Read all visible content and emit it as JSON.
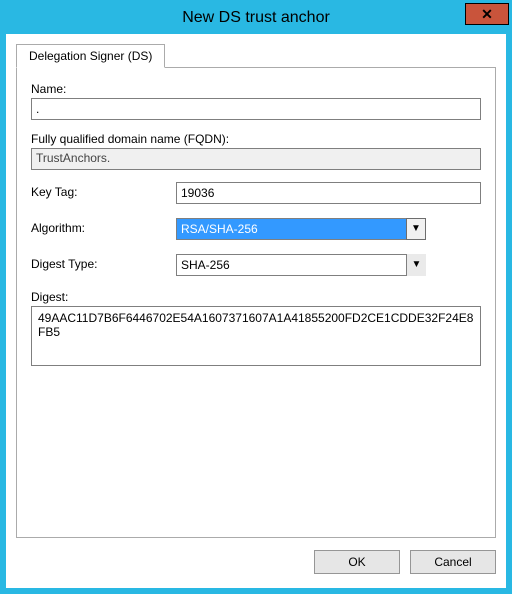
{
  "window": {
    "title": "New DS trust anchor",
    "close_icon_label": "✕"
  },
  "tab": {
    "label": "Delegation Signer (DS)"
  },
  "form": {
    "name": {
      "label": "Name:",
      "value": "."
    },
    "fqdn": {
      "label": "Fully qualified domain name (FQDN):",
      "value": "TrustAnchors."
    },
    "key_tag": {
      "label": "Key Tag:",
      "value": "19036"
    },
    "algorithm": {
      "label": "Algorithm:",
      "value": "RSA/SHA-256"
    },
    "digest_type": {
      "label": "Digest Type:",
      "value": "SHA-256"
    },
    "digest": {
      "label": "Digest:",
      "value": "49AAC11D7B6F6446702E54A1607371607A1A41855200FD2CE1CDDE32F24E8FB5"
    }
  },
  "buttons": {
    "ok": "OK",
    "cancel": "Cancel"
  },
  "glyph": {
    "caret_down": "▼"
  }
}
